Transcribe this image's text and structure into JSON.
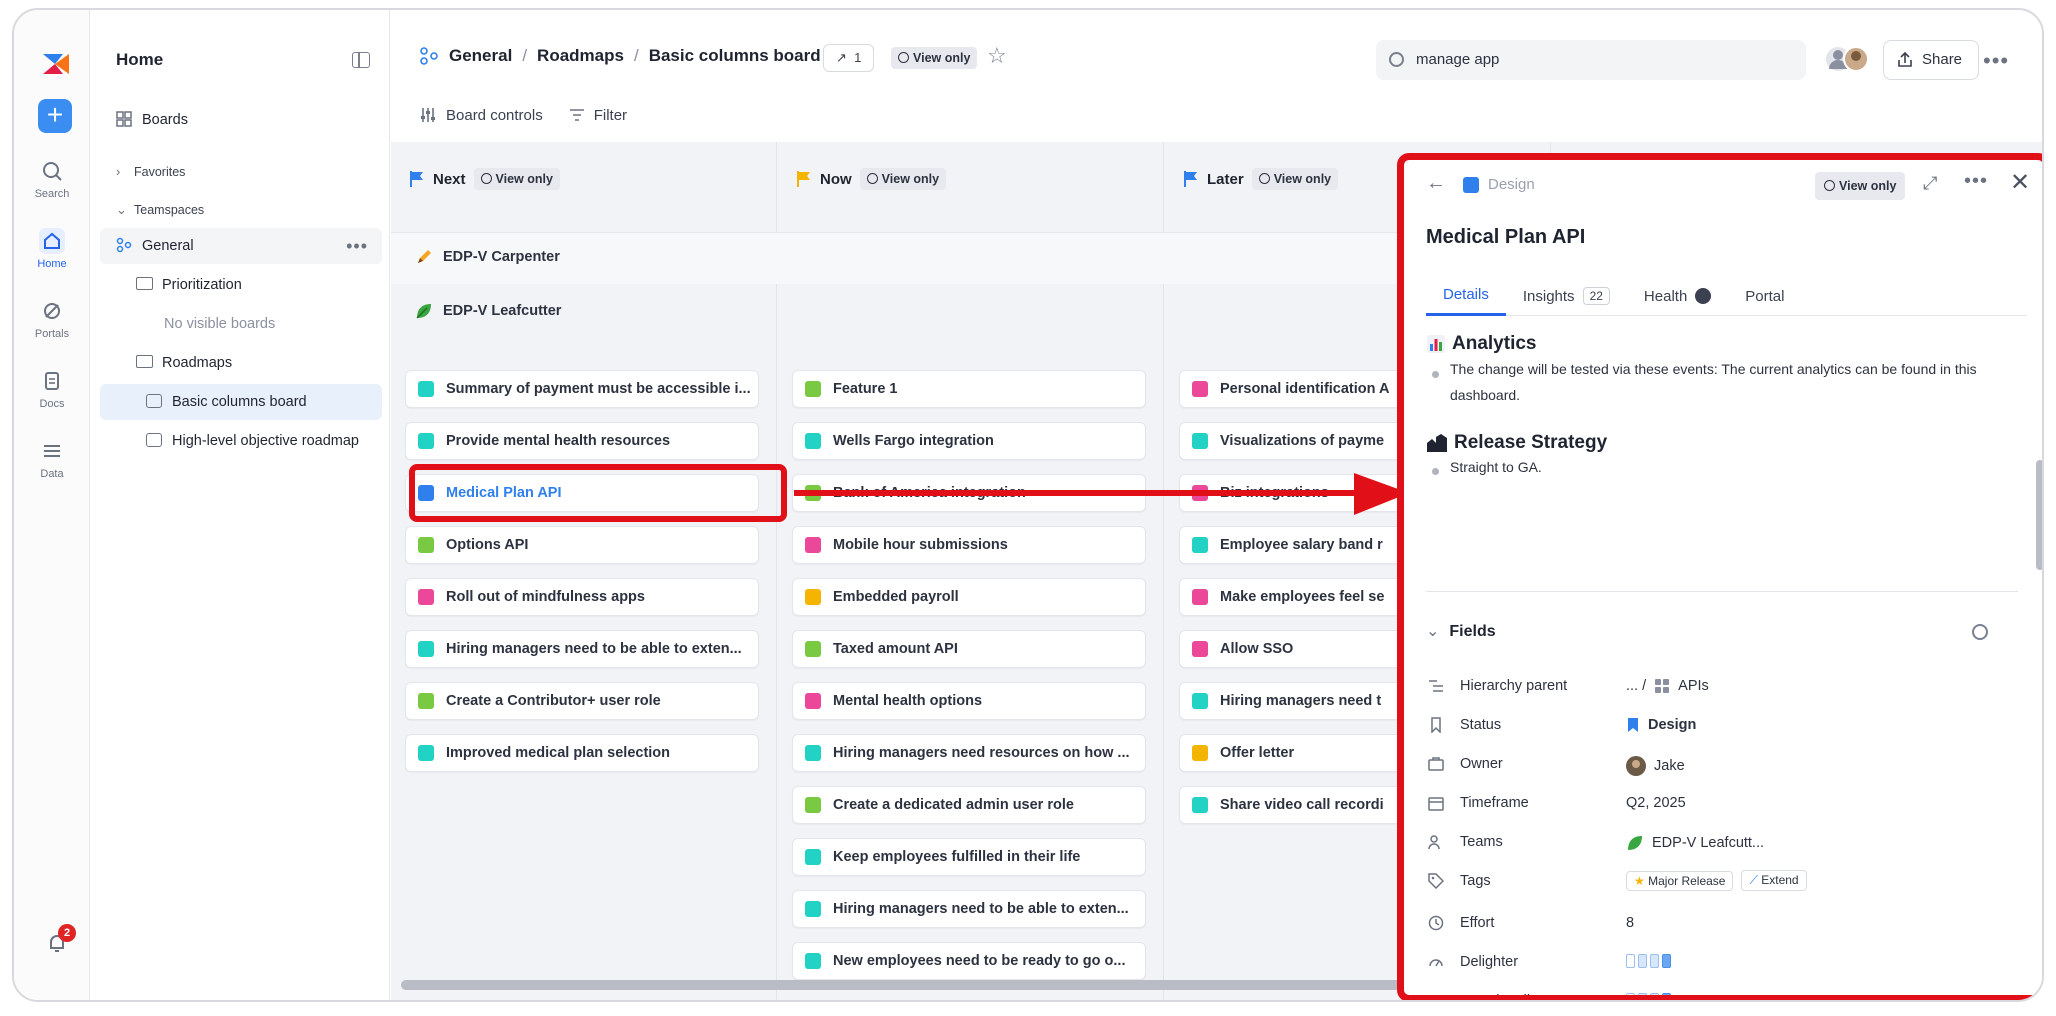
{
  "sidebar": {
    "title": "Home",
    "boards_label": "Boards",
    "favorites_label": "Favorites",
    "teamspaces_label": "Teamspaces",
    "general_label": "General",
    "prioritization_label": "Prioritization",
    "no_boards_label": "No visible boards",
    "roadmaps_label": "Roadmaps",
    "basic_columns_label": "Basic columns board",
    "high_level_label": "High-level objective roadmap"
  },
  "rail": {
    "search": "Search",
    "home": "Home",
    "portals": "Portals",
    "docs": "Docs",
    "data": "Data",
    "notifications_count": "2"
  },
  "header": {
    "crumb_1": "General",
    "crumb_2": "Roadmaps",
    "crumb_3": "Basic columns board",
    "link_count": "1",
    "view_only": "View only",
    "search_value": "manage app",
    "share": "Share",
    "board_controls": "Board controls",
    "filter": "Filter"
  },
  "columns": [
    {
      "title": "Next",
      "view_only": "View only",
      "flag_color": "#2f80ed",
      "cards": [
        {
          "label": "Summary of payment must be accessible i...",
          "color": "#22d3c5"
        },
        {
          "label": "Provide mental health resources",
          "color": "#22d3c5"
        },
        {
          "label": "Medical Plan API",
          "color": "#2f80ed"
        },
        {
          "label": "Options API",
          "color": "#7ac943"
        },
        {
          "label": "Roll out of mindfulness apps",
          "color": "#ec4899"
        },
        {
          "label": "Hiring managers need to be able to exten...",
          "color": "#22d3c5"
        },
        {
          "label": "Create a Contributor+ user role",
          "color": "#7ac943"
        },
        {
          "label": "Improved medical plan selection",
          "color": "#22d3c5"
        }
      ]
    },
    {
      "title": "Now",
      "view_only": "View only",
      "flag_color": "#f5b400",
      "cards": [
        {
          "label": "Feature 1",
          "color": "#7ac943"
        },
        {
          "label": "Wells Fargo integration",
          "color": "#22d3c5"
        },
        {
          "label": "Bank of America integration",
          "color": "#7ac943"
        },
        {
          "label": "Mobile hour submissions",
          "color": "#ec4899"
        },
        {
          "label": "Embedded payroll",
          "color": "#f5b400"
        },
        {
          "label": "Taxed amount API",
          "color": "#7ac943"
        },
        {
          "label": "Mental health options",
          "color": "#ec4899"
        },
        {
          "label": "Hiring managers need resources on how ...",
          "color": "#22d3c5"
        },
        {
          "label": "Create a dedicated admin user role",
          "color": "#7ac943"
        },
        {
          "label": "Keep employees fulfilled in their life",
          "color": "#22d3c5"
        },
        {
          "label": "Hiring managers need to be able to exten...",
          "color": "#22d3c5"
        },
        {
          "label": "New employees need to be ready to go o...",
          "color": "#22d3c5"
        }
      ]
    },
    {
      "title": "Later",
      "view_only": "View only",
      "flag_color": "#2f80ed",
      "cards": [
        {
          "label": "Personal identification A",
          "color": "#ec4899"
        },
        {
          "label": "Visualizations of payme",
          "color": "#22d3c5"
        },
        {
          "label": "Biz integrations",
          "color": "#ec4899"
        },
        {
          "label": "Employee salary band r",
          "color": "#22d3c5"
        },
        {
          "label": "Make employees feel se",
          "color": "#ec4899"
        },
        {
          "label": "Allow SSO",
          "color": "#ec4899"
        },
        {
          "label": "Hiring managers need t",
          "color": "#22d3c5"
        },
        {
          "label": "Offer letter",
          "color": "#f5b400"
        },
        {
          "label": "Share video call recordi",
          "color": "#22d3c5"
        }
      ]
    }
  ],
  "lanes": {
    "lane_1": "EDP-V Carpenter",
    "lane_2": "EDP-V Leafcutter"
  },
  "panel": {
    "status": "Design",
    "view_only": "View only",
    "title": "Medical Plan API",
    "tabs": {
      "details": "Details",
      "insights": "Insights",
      "insights_count": "22",
      "health": "Health",
      "portal": "Portal"
    },
    "analytics_title": "Analytics",
    "analytics_text": "The change will be tested via these events: The current analytics can be found in this dashboard.",
    "release_title": "Release Strategy",
    "release_text": "Straight to GA.",
    "fields_title": "Fields",
    "fields": {
      "hierarchy_label": "Hierarchy parent",
      "hierarchy_value_prefix": "... /",
      "hierarchy_value": "APIs",
      "status_label": "Status",
      "status_value": "Design",
      "owner_label": "Owner",
      "owner_value": "Jake",
      "timeframe_label": "Timeframe",
      "timeframe_value": "Q2, 2025",
      "teams_label": "Teams",
      "teams_value": "EDP-V Leafcutt...",
      "tags_label": "Tags",
      "tag_1": "Major Release",
      "tag_2": "Extend",
      "effort_label": "Effort",
      "effort_value": "8",
      "delighter_label": "Delighter",
      "functionality_label": "Functionality"
    }
  }
}
